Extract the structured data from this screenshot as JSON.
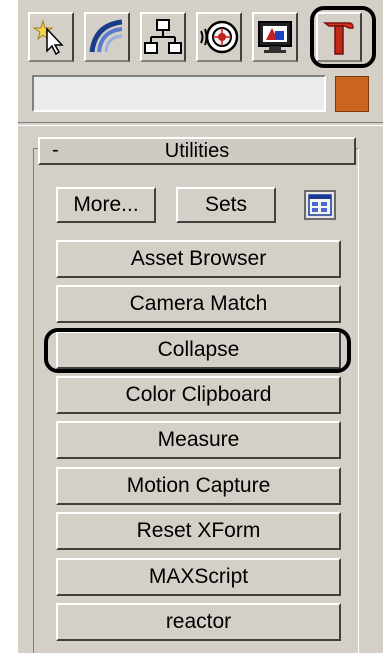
{
  "tabs": [
    {
      "name": "create-tab",
      "icon": "create-icon"
    },
    {
      "name": "modify-tab",
      "icon": "modify-icon"
    },
    {
      "name": "hierarchy-tab",
      "icon": "hierarchy-icon"
    },
    {
      "name": "motion-tab",
      "icon": "motion-icon"
    },
    {
      "name": "display-tab",
      "icon": "display-icon"
    },
    {
      "name": "utilities-tab",
      "icon": "hammer-icon",
      "active": true
    }
  ],
  "object_name": {
    "value": ""
  },
  "color_swatch": {
    "color": "#c96520"
  },
  "rollout": {
    "collapse_symbol": "-",
    "title": "Utilities"
  },
  "toolbar": {
    "more_label": "More...",
    "sets_label": "Sets",
    "config_icon": "configure-button-sets-icon"
  },
  "utilities": [
    {
      "label": "Asset Browser"
    },
    {
      "label": "Camera Match"
    },
    {
      "label": "Collapse",
      "highlighted": true
    },
    {
      "label": "Color Clipboard"
    },
    {
      "label": "Measure"
    },
    {
      "label": "Motion Capture"
    },
    {
      "label": "Reset XForm"
    },
    {
      "label": "MAXScript"
    },
    {
      "label": "reactor"
    }
  ],
  "highlight_color": "#000000"
}
